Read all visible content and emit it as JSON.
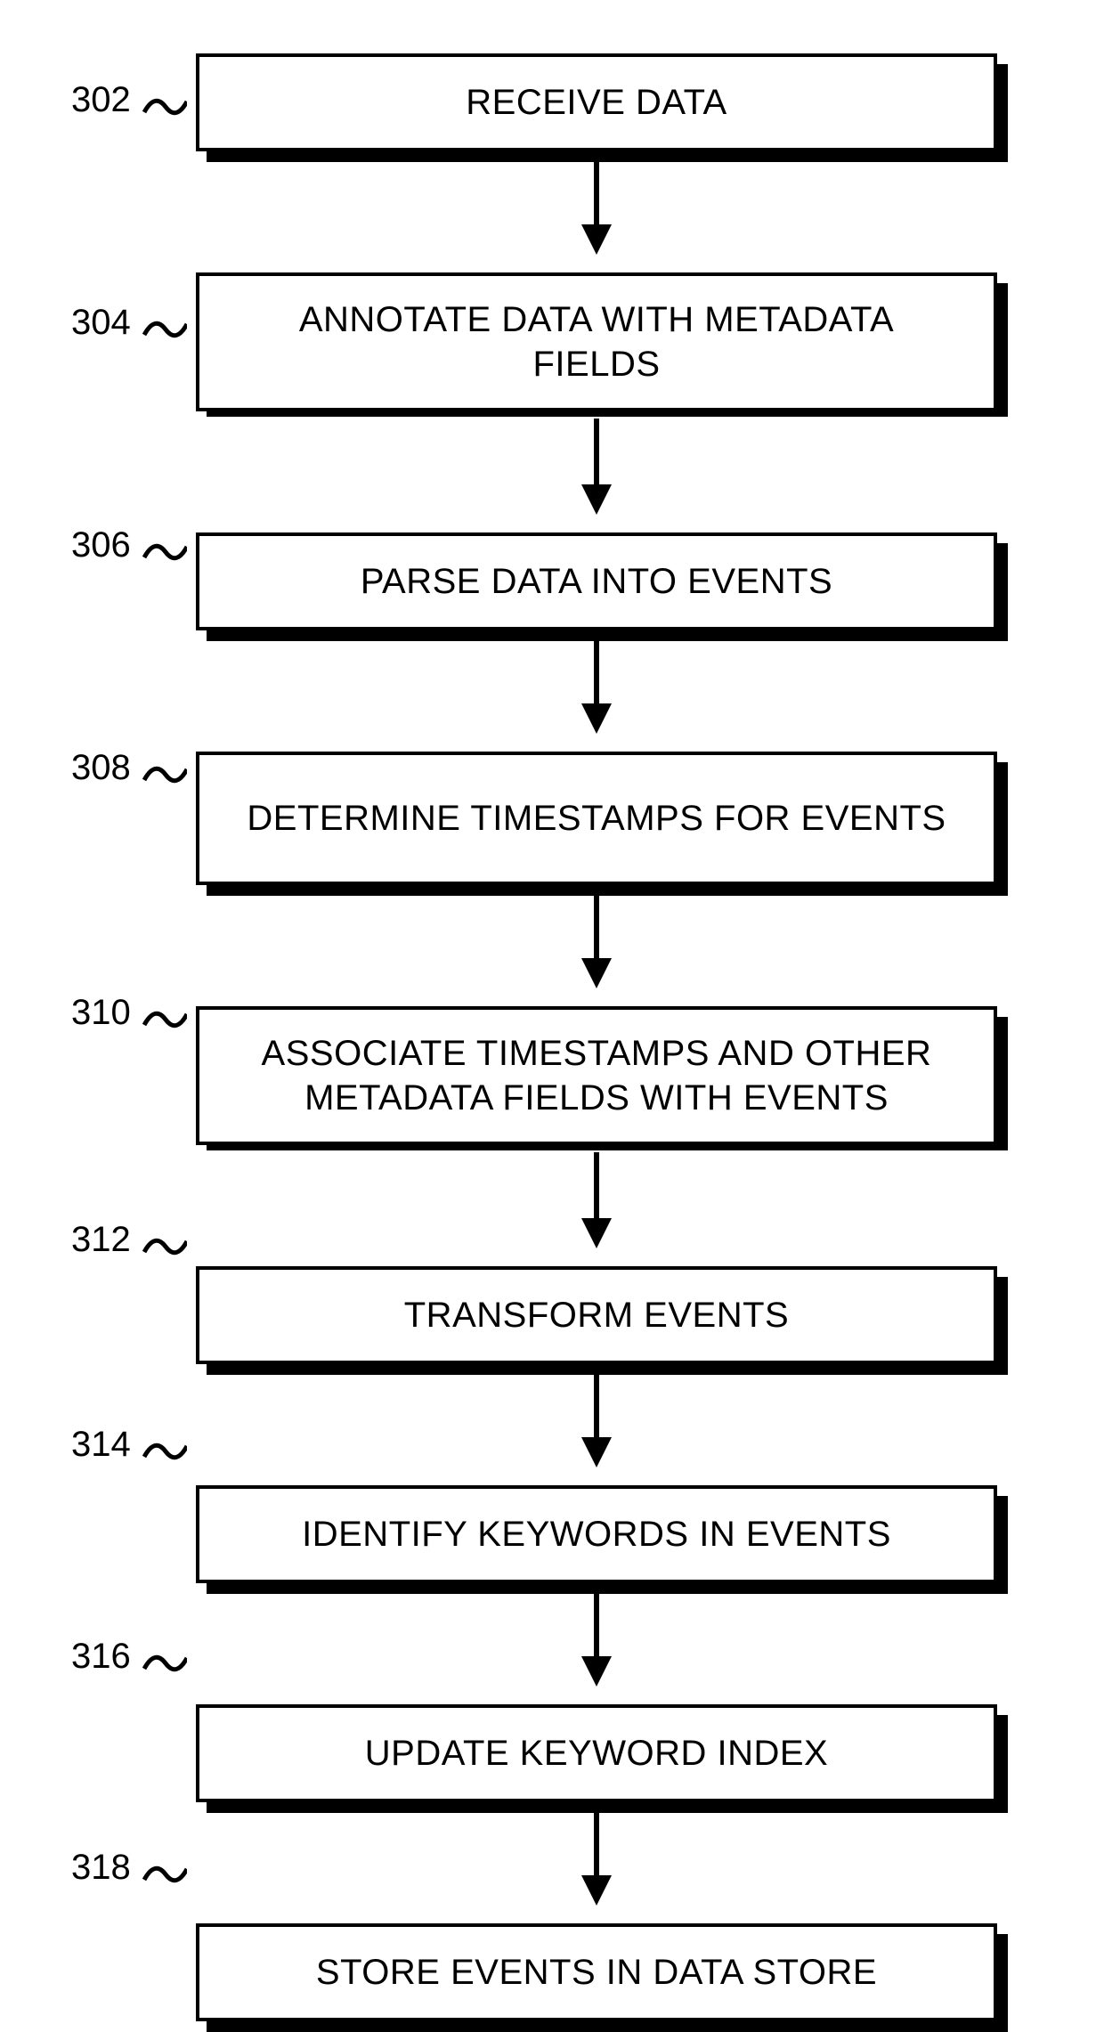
{
  "steps": [
    {
      "num": "302",
      "text": "RECEIVE DATA"
    },
    {
      "num": "304",
      "text": "ANNOTATE DATA WITH METADATA FIELDS"
    },
    {
      "num": "306",
      "text": "PARSE DATA INTO EVENTS"
    },
    {
      "num": "308",
      "text": "DETERMINE TIMESTAMPS FOR EVENTS"
    },
    {
      "num": "310",
      "text": "ASSOCIATE TIMESTAMPS AND OTHER METADATA FIELDS WITH EVENTS"
    },
    {
      "num": "312",
      "text": "TRANSFORM EVENTS"
    },
    {
      "num": "314",
      "text": "IDENTIFY KEYWORDS IN EVENTS"
    },
    {
      "num": "316",
      "text": "UPDATE KEYWORD INDEX"
    },
    {
      "num": "318",
      "text": "STORE EVENTS IN DATA STORE"
    }
  ]
}
